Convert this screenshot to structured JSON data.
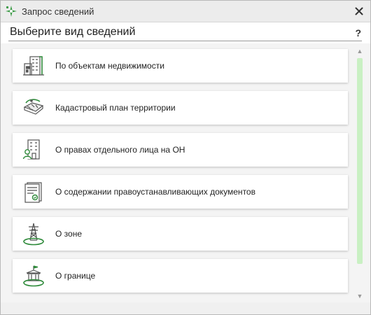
{
  "window": {
    "title": "Запрос сведений",
    "close_symbol": "✕"
  },
  "header": {
    "title": "Выберите вид сведений",
    "help_label": "?"
  },
  "items": [
    {
      "label": "По объектам недвижимости",
      "icon": "buildings-icon"
    },
    {
      "label": "Кадастровый план территории",
      "icon": "map-territory-icon"
    },
    {
      "label": "О правах отдельного лица на ОН",
      "icon": "person-building-icon"
    },
    {
      "label": "О содержании правоустанавливающих документов",
      "icon": "document-stamp-icon"
    },
    {
      "label": "О зоне",
      "icon": "power-tower-zone-icon"
    },
    {
      "label": "О границе",
      "icon": "government-boundary-icon"
    }
  ],
  "scrollbar": {
    "up_symbol": "▲",
    "down_symbol": "▼"
  },
  "colors": {
    "accent_green": "#2e8a3a",
    "icon_gray": "#555555",
    "scroll_thumb": "#c9f0c3"
  }
}
